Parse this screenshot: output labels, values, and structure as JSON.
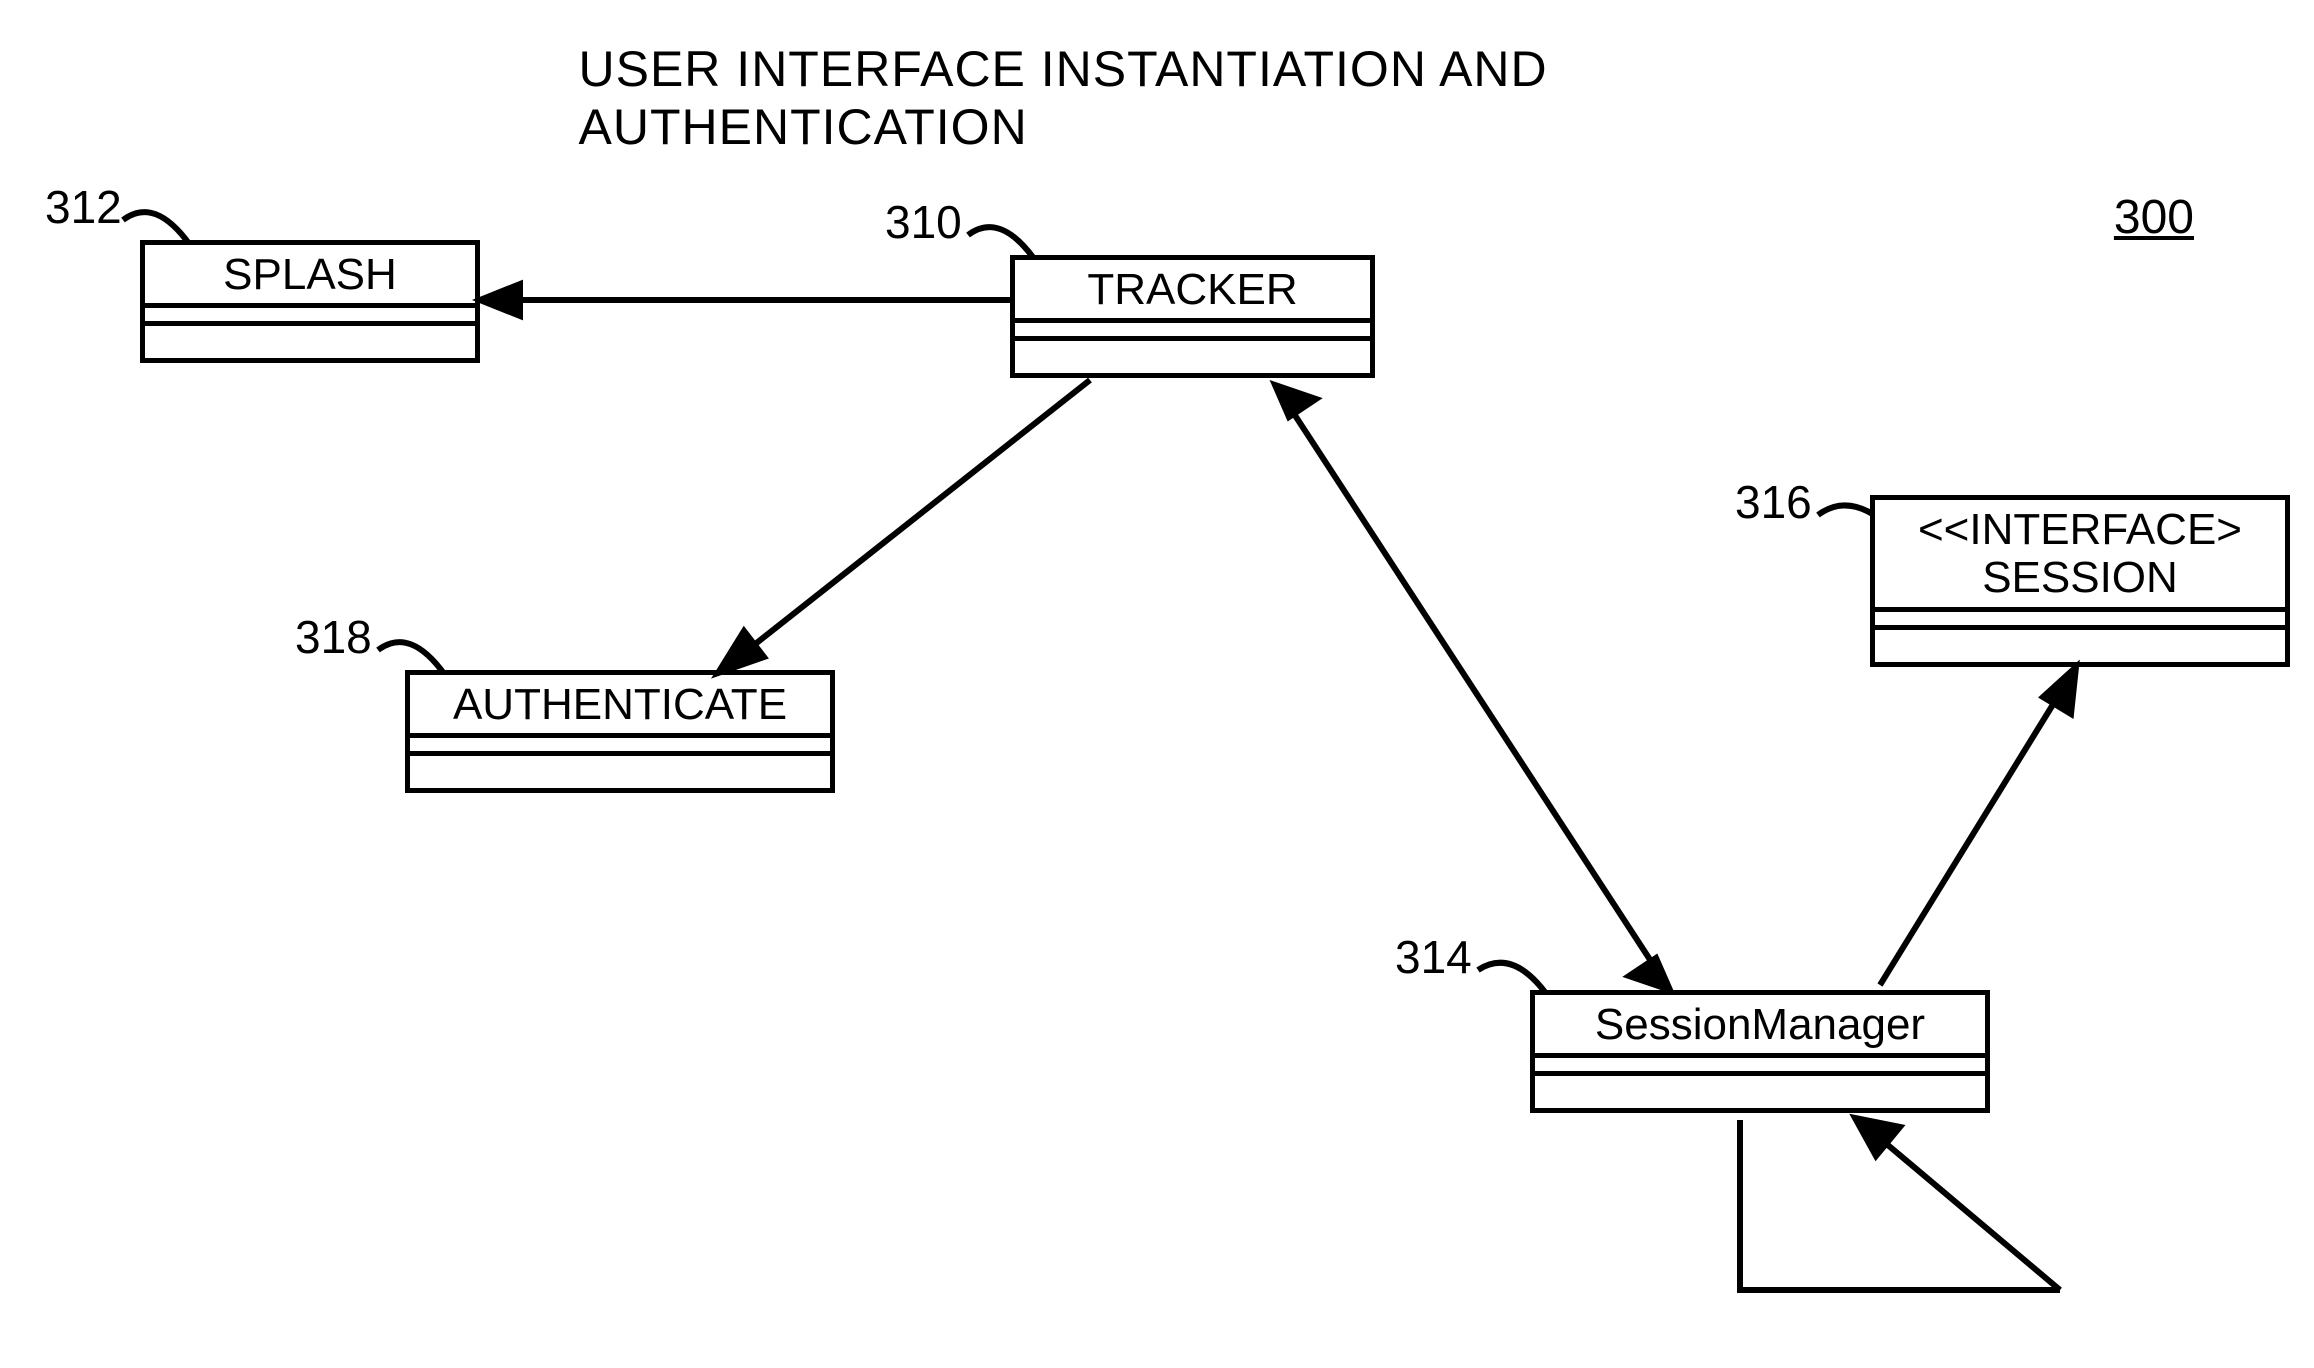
{
  "title": "USER INTERFACE INSTANTIATION AND AUTHENTICATION",
  "figure_number": "300",
  "classes": {
    "tracker": {
      "label": "310",
      "name": "TRACKER"
    },
    "splash": {
      "label": "312",
      "name": "SPLASH"
    },
    "sessionMgr": {
      "label": "314",
      "name": "SessionManager"
    },
    "session": {
      "label": "316",
      "name": "<<INTERFACE>\nSESSION"
    },
    "authenticate": {
      "label": "318",
      "name": "AUTHENTICATE"
    }
  }
}
